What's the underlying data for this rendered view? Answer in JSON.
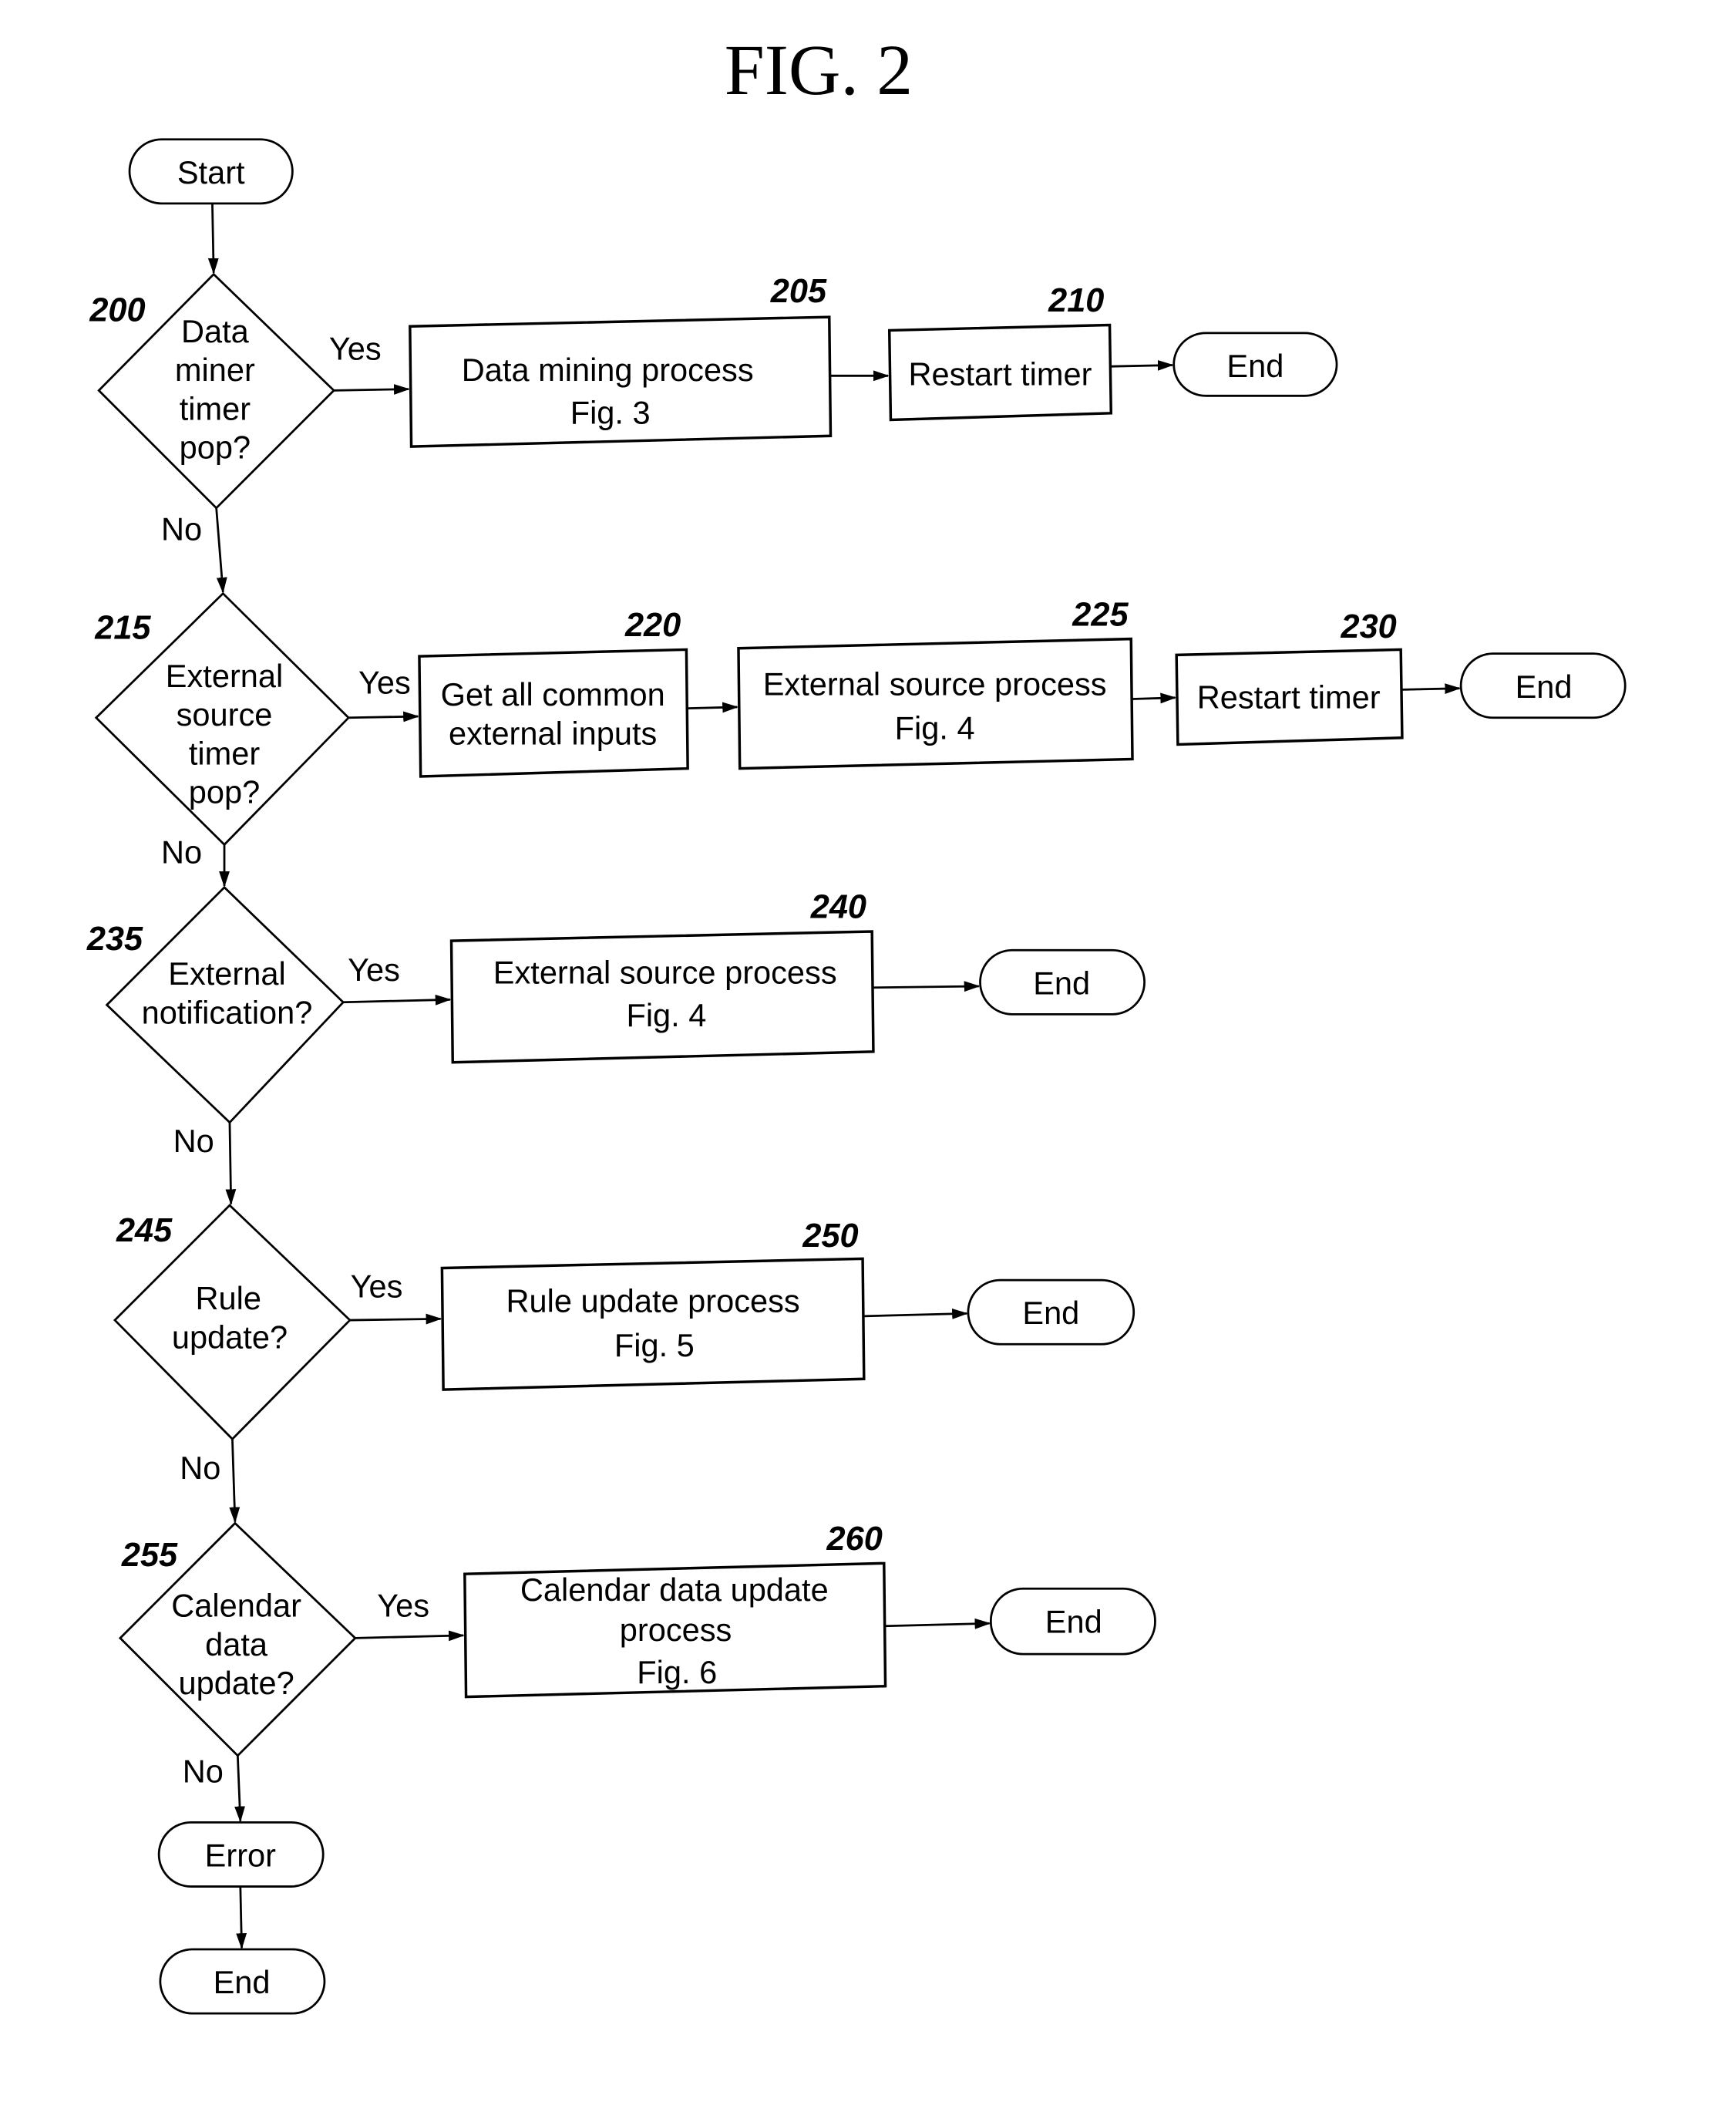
{
  "figure": {
    "title": "FIG. 2"
  },
  "colors": {
    "ink": "#000000",
    "background": "#ffffff"
  },
  "nodes": {
    "start": {
      "label": "Start"
    },
    "d200": {
      "ref": "200",
      "lines": [
        "Data",
        "miner",
        "timer",
        "pop?"
      ]
    },
    "p205": {
      "ref": "205",
      "lines": [
        "Data mining process",
        "Fig. 3"
      ]
    },
    "p210": {
      "ref": "210",
      "lines": [
        "Restart timer"
      ]
    },
    "end1": {
      "label": "End"
    },
    "d215": {
      "ref": "215",
      "lines": [
        "External",
        "source",
        "timer",
        "pop?"
      ]
    },
    "p220": {
      "ref": "220",
      "lines": [
        "Get all common",
        "external inputs"
      ]
    },
    "p225": {
      "ref": "225",
      "lines": [
        "External source process",
        "Fig. 4"
      ]
    },
    "p230": {
      "ref": "230",
      "lines": [
        "Restart timer"
      ]
    },
    "end2": {
      "label": "End"
    },
    "d235": {
      "ref": "235",
      "lines": [
        "External",
        "notification?"
      ]
    },
    "p240": {
      "ref": "240",
      "lines": [
        "External source process",
        "Fig. 4"
      ]
    },
    "end3": {
      "label": "End"
    },
    "d245": {
      "ref": "245",
      "lines": [
        "Rule",
        "update?"
      ]
    },
    "p250": {
      "ref": "250",
      "lines": [
        "Rule update process",
        "Fig. 5"
      ]
    },
    "end4": {
      "label": "End"
    },
    "d255": {
      "ref": "255",
      "lines": [
        "Calendar",
        "data",
        "update?"
      ]
    },
    "p260": {
      "ref": "260",
      "lines": [
        "Calendar data update",
        "process",
        "Fig. 6"
      ]
    },
    "end5": {
      "label": "End"
    },
    "error": {
      "label": "Error"
    },
    "end6": {
      "label": "End"
    }
  },
  "edge_labels": {
    "yes": "Yes",
    "no": "No"
  }
}
